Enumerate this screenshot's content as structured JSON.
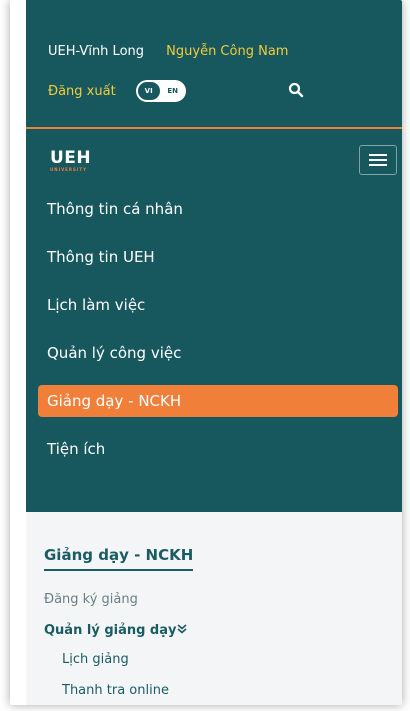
{
  "header": {
    "campus": "UEH-Vĩnh Long",
    "user_name": "Nguyễn Công Nam",
    "logout": "Đăng xuất",
    "lang_vi": "VI",
    "lang_en": "EN",
    "search_icon": "search-icon"
  },
  "brand": {
    "logo_text": "UEH",
    "logo_sub": "UNIVERSITY"
  },
  "nav": {
    "items": [
      {
        "label": "Thông tin cá nhân"
      },
      {
        "label": "Thông tin UEH"
      },
      {
        "label": "Lịch làm việc"
      },
      {
        "label": "Quản lý công việc"
      },
      {
        "label": "Giảng dạy - NCKH"
      },
      {
        "label": "Tiện ích"
      }
    ],
    "active_index": 4
  },
  "submenu": {
    "title": "Giảng dạy - NCKH",
    "register": "Đăng ký giảng",
    "manage": "Quản lý giảng dạy",
    "schedule": "Lịch giảng",
    "inspect": "Thanh tra online"
  },
  "colors": {
    "teal": "#17585f",
    "orange": "#f07f3a",
    "yellow": "#f1cb3b"
  }
}
